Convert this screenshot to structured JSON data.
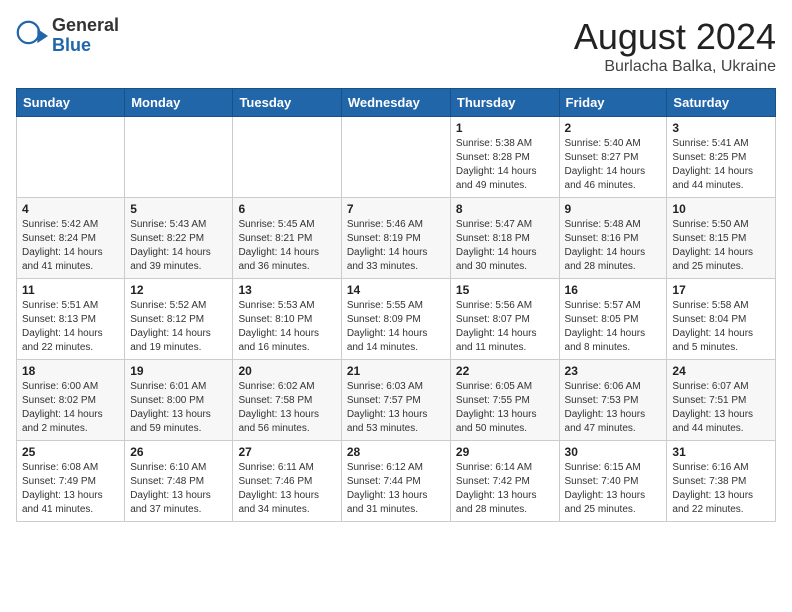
{
  "header": {
    "logo_general": "General",
    "logo_blue": "Blue",
    "month_year": "August 2024",
    "location": "Burlacha Balka, Ukraine"
  },
  "days_of_week": [
    "Sunday",
    "Monday",
    "Tuesday",
    "Wednesday",
    "Thursday",
    "Friday",
    "Saturday"
  ],
  "weeks": [
    [
      {
        "day": "",
        "info": ""
      },
      {
        "day": "",
        "info": ""
      },
      {
        "day": "",
        "info": ""
      },
      {
        "day": "",
        "info": ""
      },
      {
        "day": "1",
        "info": "Sunrise: 5:38 AM\nSunset: 8:28 PM\nDaylight: 14 hours\nand 49 minutes."
      },
      {
        "day": "2",
        "info": "Sunrise: 5:40 AM\nSunset: 8:27 PM\nDaylight: 14 hours\nand 46 minutes."
      },
      {
        "day": "3",
        "info": "Sunrise: 5:41 AM\nSunset: 8:25 PM\nDaylight: 14 hours\nand 44 minutes."
      }
    ],
    [
      {
        "day": "4",
        "info": "Sunrise: 5:42 AM\nSunset: 8:24 PM\nDaylight: 14 hours\nand 41 minutes."
      },
      {
        "day": "5",
        "info": "Sunrise: 5:43 AM\nSunset: 8:22 PM\nDaylight: 14 hours\nand 39 minutes."
      },
      {
        "day": "6",
        "info": "Sunrise: 5:45 AM\nSunset: 8:21 PM\nDaylight: 14 hours\nand 36 minutes."
      },
      {
        "day": "7",
        "info": "Sunrise: 5:46 AM\nSunset: 8:19 PM\nDaylight: 14 hours\nand 33 minutes."
      },
      {
        "day": "8",
        "info": "Sunrise: 5:47 AM\nSunset: 8:18 PM\nDaylight: 14 hours\nand 30 minutes."
      },
      {
        "day": "9",
        "info": "Sunrise: 5:48 AM\nSunset: 8:16 PM\nDaylight: 14 hours\nand 28 minutes."
      },
      {
        "day": "10",
        "info": "Sunrise: 5:50 AM\nSunset: 8:15 PM\nDaylight: 14 hours\nand 25 minutes."
      }
    ],
    [
      {
        "day": "11",
        "info": "Sunrise: 5:51 AM\nSunset: 8:13 PM\nDaylight: 14 hours\nand 22 minutes."
      },
      {
        "day": "12",
        "info": "Sunrise: 5:52 AM\nSunset: 8:12 PM\nDaylight: 14 hours\nand 19 minutes."
      },
      {
        "day": "13",
        "info": "Sunrise: 5:53 AM\nSunset: 8:10 PM\nDaylight: 14 hours\nand 16 minutes."
      },
      {
        "day": "14",
        "info": "Sunrise: 5:55 AM\nSunset: 8:09 PM\nDaylight: 14 hours\nand 14 minutes."
      },
      {
        "day": "15",
        "info": "Sunrise: 5:56 AM\nSunset: 8:07 PM\nDaylight: 14 hours\nand 11 minutes."
      },
      {
        "day": "16",
        "info": "Sunrise: 5:57 AM\nSunset: 8:05 PM\nDaylight: 14 hours\nand 8 minutes."
      },
      {
        "day": "17",
        "info": "Sunrise: 5:58 AM\nSunset: 8:04 PM\nDaylight: 14 hours\nand 5 minutes."
      }
    ],
    [
      {
        "day": "18",
        "info": "Sunrise: 6:00 AM\nSunset: 8:02 PM\nDaylight: 14 hours\nand 2 minutes."
      },
      {
        "day": "19",
        "info": "Sunrise: 6:01 AM\nSunset: 8:00 PM\nDaylight: 13 hours\nand 59 minutes."
      },
      {
        "day": "20",
        "info": "Sunrise: 6:02 AM\nSunset: 7:58 PM\nDaylight: 13 hours\nand 56 minutes."
      },
      {
        "day": "21",
        "info": "Sunrise: 6:03 AM\nSunset: 7:57 PM\nDaylight: 13 hours\nand 53 minutes."
      },
      {
        "day": "22",
        "info": "Sunrise: 6:05 AM\nSunset: 7:55 PM\nDaylight: 13 hours\nand 50 minutes."
      },
      {
        "day": "23",
        "info": "Sunrise: 6:06 AM\nSunset: 7:53 PM\nDaylight: 13 hours\nand 47 minutes."
      },
      {
        "day": "24",
        "info": "Sunrise: 6:07 AM\nSunset: 7:51 PM\nDaylight: 13 hours\nand 44 minutes."
      }
    ],
    [
      {
        "day": "25",
        "info": "Sunrise: 6:08 AM\nSunset: 7:49 PM\nDaylight: 13 hours\nand 41 minutes."
      },
      {
        "day": "26",
        "info": "Sunrise: 6:10 AM\nSunset: 7:48 PM\nDaylight: 13 hours\nand 37 minutes."
      },
      {
        "day": "27",
        "info": "Sunrise: 6:11 AM\nSunset: 7:46 PM\nDaylight: 13 hours\nand 34 minutes."
      },
      {
        "day": "28",
        "info": "Sunrise: 6:12 AM\nSunset: 7:44 PM\nDaylight: 13 hours\nand 31 minutes."
      },
      {
        "day": "29",
        "info": "Sunrise: 6:14 AM\nSunset: 7:42 PM\nDaylight: 13 hours\nand 28 minutes."
      },
      {
        "day": "30",
        "info": "Sunrise: 6:15 AM\nSunset: 7:40 PM\nDaylight: 13 hours\nand 25 minutes."
      },
      {
        "day": "31",
        "info": "Sunrise: 6:16 AM\nSunset: 7:38 PM\nDaylight: 13 hours\nand 22 minutes."
      }
    ]
  ]
}
